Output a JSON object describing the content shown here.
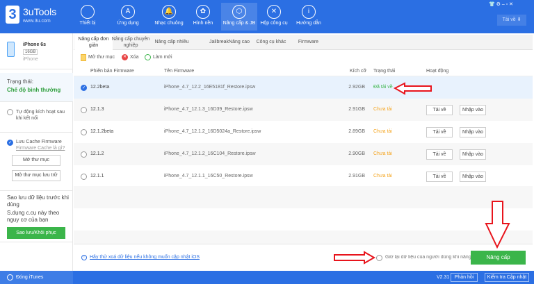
{
  "app": {
    "logo": "3",
    "name": "3uTools",
    "url": "www.3u.com"
  },
  "nav": [
    {
      "label": "Thiết bị",
      "icon": ""
    },
    {
      "label": "Ứng dụng",
      "icon": "A"
    },
    {
      "label": "Nhạc chuông",
      "icon": "🔔"
    },
    {
      "label": "Hình nền",
      "icon": "✿"
    },
    {
      "label": "Nâng cấp & JB",
      "icon": "⬡"
    },
    {
      "label": "Hộp công cụ",
      "icon": "✕"
    },
    {
      "label": "Hướng dẫn",
      "icon": "i"
    }
  ],
  "header": {
    "download": "Tải về ⬇",
    "window_controls": "👕 ⚙ – ▫ ✕"
  },
  "device": {
    "name": "iPhone 6s",
    "capacity": "16GB",
    "type": "iPhone"
  },
  "sidebar": {
    "status_label": "Trạng thái:",
    "status_value": "Chế độ bình thường",
    "auto_activate": "Tự động kích hoạt sau khi kết nối",
    "cache_label": "Lưu Cache Firmware",
    "cache_link": "Firmware Cache là gì?",
    "open_folder": "Mở thư mục",
    "open_storage": "Mở thư mục lưu trữ",
    "backup_note1": "Sao lưu dữ liệu trước khi dùng",
    "backup_note2": "S.dụng c.cụ này theo nguy cơ của bạn",
    "backup_btn": "Sao lưu/Khôi phục"
  },
  "tabs": [
    "Nâng cấp đơn giản",
    "Nâng cấp chuyên nghiệp",
    "Nâng cấp nhiều",
    "Jailbreak",
    "Nâng cao",
    "Công cụ khác",
    "Firmware"
  ],
  "toolbar": {
    "open": "Mở thư mục",
    "delete": "Xóa",
    "refresh": "Làm mới"
  },
  "table": {
    "headers": [
      "Phiên bản Firmware",
      "Tên Firmware",
      "Kích cỡ",
      "Trạng thái",
      "Hoạt động"
    ],
    "rows": [
      {
        "version": "12.2beta",
        "name": "iPhone_4.7_12.2_16E5181f_Restore.ipsw",
        "size": "2.92GB",
        "status": "Đã tải về",
        "selected": true
      },
      {
        "version": "12.1.3",
        "name": "iPhone_4.7_12.1.3_16D39_Restore.ipsw",
        "size": "2.91GB",
        "status": "Chưa tải",
        "download": "Tải về",
        "import": "Nhập vào"
      },
      {
        "version": "12.1.2beta",
        "name": "iPhone_4.7_12.1.2_16D5024a_Restore.ipsw",
        "size": "2.89GB",
        "status": "Chưa tải",
        "download": "Tải về",
        "import": "Nhập vào"
      },
      {
        "version": "12.1.2",
        "name": "iPhone_4.7_12.1.2_16C104_Restore.ipsw",
        "size": "2.90GB",
        "status": "Chưa tải",
        "download": "Tải về",
        "import": "Nhập vào"
      },
      {
        "version": "12.1.1",
        "name": "iPhone_4.7_12.1.1_16C50_Restore.ipsw",
        "size": "2.91GB",
        "status": "Chưa tải",
        "download": "Tải về",
        "import": "Nhập vào"
      }
    ]
  },
  "bottom": {
    "hint": "Hãy thử xoá dữ liệu nếu không muốn cập nhật iOS",
    "keep_data": "Giữ lại dữ liệu của người dùng khi nâng cấp",
    "upgrade": "Nâng cấp"
  },
  "statusbar": {
    "itunes": "Đóng iTunes",
    "version": "V2.31",
    "feedback": "Phản hồi",
    "check_update": "Kiểm tra Cập nhật"
  },
  "colors": {
    "brand": "#2b6fe3",
    "green": "#3bb54a",
    "orange": "#f5a623",
    "arrow": "#e8141c"
  }
}
